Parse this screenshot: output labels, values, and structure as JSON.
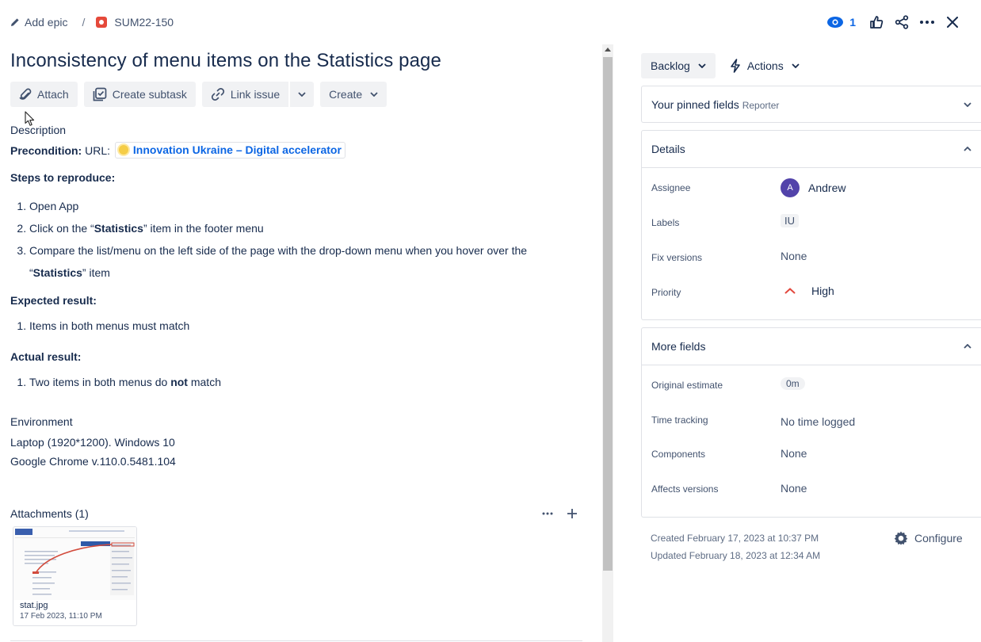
{
  "breadcrumb": {
    "add_epic": "Add epic",
    "separator": "/",
    "issue_key": "SUM22-150"
  },
  "header": {
    "watch_count": "1"
  },
  "title": "Inconsistency of menu items on the Statistics page",
  "toolbar": {
    "attach": "Attach",
    "create_subtask": "Create subtask",
    "link_issue": "Link issue",
    "create": "Create"
  },
  "description": {
    "label": "Description",
    "precondition_label": "Precondition:",
    "url_label": "URL:",
    "link_text": "Innovation Ukraine – Digital accelerator",
    "steps_heading": "Steps to reproduce:",
    "steps": {
      "s1": "Open App",
      "s2a": "Click on the “",
      "s2b": "Statistics",
      "s2c": "” item in the footer menu",
      "s3a": "Compare the list/menu on the left side of the page with the drop-down menu when you hover over the “",
      "s3b": "Statistics",
      "s3c": "” item"
    },
    "expected_heading": "Expected result:",
    "expected_1": "Items in both menus must match",
    "actual_heading": "Actual result:",
    "actual_a": "Two items in both menus do ",
    "actual_b": "not",
    "actual_c": " match"
  },
  "environment": {
    "label": "Environment",
    "line1": "Laptop (1920*1200). Windows 10",
    "line2": "Google Chrome v.110.0.5481.104"
  },
  "attachments": {
    "label": "Attachments (1)",
    "file_name": "stat.jpg",
    "file_date": "17 Feb 2023, 11:10 PM"
  },
  "status": {
    "current": "Backlog",
    "actions": "Actions"
  },
  "pinned": {
    "title": "Your pinned fields",
    "subtitle": "Reporter"
  },
  "details": {
    "title": "Details",
    "assignee_label": "Assignee",
    "assignee_initial": "A",
    "assignee_name": "Andrew",
    "labels_label": "Labels",
    "labels_value": "IU",
    "fix_versions_label": "Fix versions",
    "fix_versions_value": "None",
    "priority_label": "Priority",
    "priority_value": "High"
  },
  "more_fields": {
    "title": "More fields",
    "original_estimate_label": "Original estimate",
    "original_estimate_value": "0m",
    "time_tracking_label": "Time tracking",
    "time_tracking_value": "No time logged",
    "components_label": "Components",
    "components_value": "None",
    "affects_label": "Affects versions",
    "affects_value": "None"
  },
  "meta": {
    "created": "Created February 17, 2023 at 10:37 PM",
    "updated": "Updated February 18, 2023 at 12:34 AM",
    "configure": "Configure"
  },
  "colors": {
    "accent": "#0c66e4",
    "priority_high": "#e2483d",
    "bug": "#e5493a",
    "avatar": "#5243aa"
  },
  "icons": [
    "pencil-icon",
    "bug-icon",
    "eye-icon",
    "thumbs-up-icon",
    "share-icon",
    "more-icon",
    "close-icon",
    "paperclip-icon",
    "subtask-icon",
    "link-icon",
    "chevron-down-icon",
    "lightning-icon",
    "chevron-up-icon",
    "priority-high-icon",
    "gear-icon",
    "plus-icon"
  ]
}
